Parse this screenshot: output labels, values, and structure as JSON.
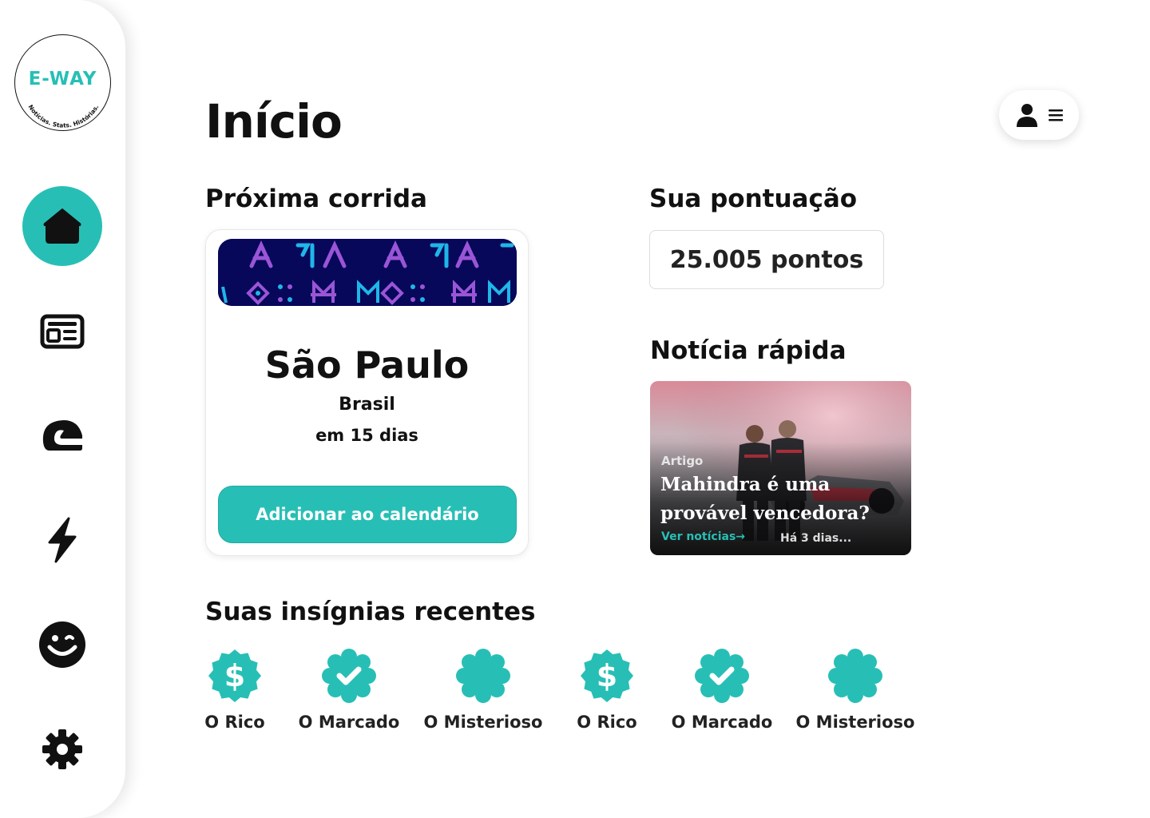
{
  "logo": {
    "title": "E-WAY",
    "subtitle": "Notícias. Stats. Histórias."
  },
  "sidebar": {
    "items": [
      {
        "name": "home",
        "icon": "home-icon",
        "active": true
      },
      {
        "name": "news",
        "icon": "newspaper-icon",
        "active": false
      },
      {
        "name": "drivers",
        "icon": "helmet-icon",
        "active": false
      },
      {
        "name": "energy",
        "icon": "lightning-icon",
        "active": false
      },
      {
        "name": "fun",
        "icon": "wink-face-icon",
        "active": false
      },
      {
        "name": "settings",
        "icon": "gear-icon",
        "active": false
      }
    ]
  },
  "header": {
    "title": "Início",
    "user_menu_icons": [
      "user-icon",
      "menu-icon"
    ]
  },
  "next_race": {
    "section_title": "Próxima corrida",
    "city": "São Paulo",
    "country": "Brasil",
    "countdown": "em 15 dias",
    "button_label": "Adicionar ao calendário"
  },
  "score": {
    "section_title": "Sua pontuação",
    "value": "25.005 pontos"
  },
  "quick_news": {
    "section_title": "Notícia rápida",
    "category": "Artigo",
    "headline": "Mahindra é uma provável vencedora?",
    "link_label": "Ver notícias",
    "time": "Há 3 dias..."
  },
  "badges": {
    "section_title": "Suas insígnias recentes",
    "items": [
      {
        "label": "O Rico",
        "icon": "dollar-badge-icon"
      },
      {
        "label": "O Marcado",
        "icon": "check-badge-icon"
      },
      {
        "label": "O Misterioso",
        "icon": "blank-badge-icon"
      },
      {
        "label": "O Rico",
        "icon": "dollar-badge-icon"
      },
      {
        "label": "O Marcado",
        "icon": "check-badge-icon"
      },
      {
        "label": "O Misterioso",
        "icon": "blank-badge-icon"
      }
    ]
  },
  "colors": {
    "accent": "#27BFB5",
    "banner_bg": "#07085a",
    "text": "#111111"
  }
}
